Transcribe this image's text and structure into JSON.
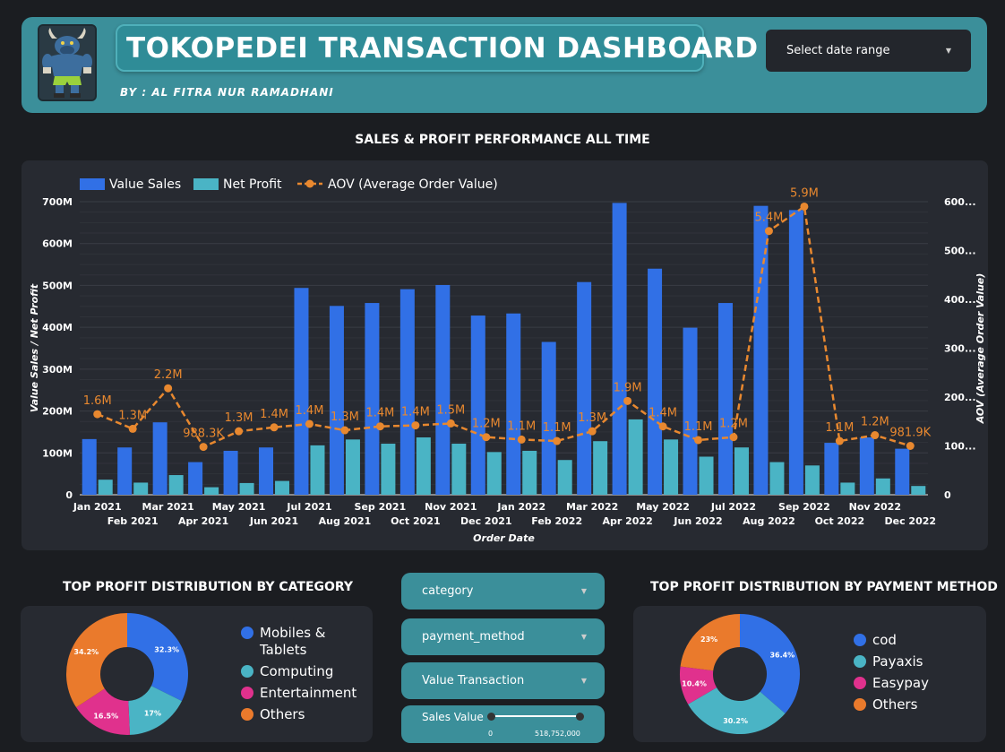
{
  "header": {
    "title": "TOKOPEDEI TRANSACTION DASHBOARD",
    "byline": "BY : AL FITRA NUR RAMADHANI",
    "date_select_label": "Select date range",
    "colors": {
      "bar": "#3b8f9a",
      "title_box": "#2f8c97"
    },
    "avatar_icon": "bull-mascot-icon"
  },
  "sections": {
    "main_chart_title": "SALES & PROFIT PERFORMANCE ALL TIME",
    "category_title": "TOP PROFIT DISTRIBUTION BY CATEGORY",
    "payment_title": "TOP PROFIT DISTRIBUTION BY PAYMENT METHOD"
  },
  "filters": {
    "category": "category",
    "payment_method": "payment_method",
    "value_transaction": "Value Transaction",
    "slider_label": "Sales Value",
    "slider_min": "0",
    "slider_max": "518,752,000"
  },
  "chart_data": [
    {
      "type": "bar",
      "title": "SALES & PROFIT PERFORMANCE ALL TIME",
      "xlabel": "Order Date",
      "ylabel": "Value Sales / Net Profit",
      "y2label": "AOV (Average Order Value)",
      "ylim": [
        0,
        700
      ],
      "y2lim": [
        0,
        600
      ],
      "yticks": [
        "0",
        "100M",
        "200M",
        "300M",
        "400M",
        "500M",
        "600M",
        "700M"
      ],
      "y2ticks": [
        "0",
        "100...",
        "200...",
        "300...",
        "400...",
        "500...",
        "600..."
      ],
      "legend": [
        "Value Sales",
        "Net Profit",
        "AOV (Average Order Value)"
      ],
      "legend_position": "top-left",
      "colors": {
        "sales": "#3170e6",
        "profit": "#4ab4c5",
        "aov": "#e8882f"
      },
      "categories": [
        "Jan 2021",
        "Feb 2021",
        "Mar 2021",
        "Apr 2021",
        "May 2021",
        "Jun 2021",
        "Jul 2021",
        "Aug 2021",
        "Sep 2021",
        "Oct 2021",
        "Nov 2021",
        "Dec 2021",
        "Jan 2022",
        "Feb 2022",
        "Mar 2022",
        "Apr 2022",
        "May 2022",
        "Jun 2022",
        "Jul 2022",
        "Aug 2022",
        "Sep 2022",
        "Oct 2022",
        "Nov 2022",
        "Dec 2022"
      ],
      "series": [
        {
          "name": "Value Sales",
          "unit": "M",
          "values": [
            133,
            113,
            173,
            78,
            105,
            113,
            494,
            451,
            458,
            491,
            501,
            428,
            433,
            365,
            508,
            697,
            540,
            399,
            458,
            690,
            680,
            124,
            137,
            110
          ]
        },
        {
          "name": "Net Profit",
          "unit": "M",
          "values": [
            36,
            29,
            47,
            18,
            28,
            33,
            118,
            132,
            122,
            137,
            122,
            102,
            105,
            83,
            128,
            180,
            132,
            91,
            113,
            78,
            70,
            29,
            39,
            21
          ]
        },
        {
          "name": "AOV (Average Order Value)",
          "values": [
            165,
            135,
            218,
            98,
            130,
            138,
            145,
            132,
            140,
            142,
            146,
            118,
            113,
            110,
            130,
            192,
            140,
            112,
            118,
            540,
            590,
            110,
            122,
            100
          ],
          "labels": [
            "1.6M",
            "1.3M",
            "2.2M",
            "988.3K",
            "1.3M",
            "1.4M",
            "1.4M",
            "1.3M",
            "1.4M",
            "1.4M",
            "1.5M",
            "1.2M",
            "1.1M",
            "1.1M",
            "1.3M",
            "1.9M",
            "1.4M",
            "1.1M",
            "1.2M",
            "5.4M",
            "5.9M",
            "1.1M",
            "1.2M",
            "981.9K"
          ]
        }
      ]
    },
    {
      "type": "pie",
      "title": "TOP PROFIT DISTRIBUTION BY CATEGORY",
      "categories": [
        "Mobiles & Tablets",
        "Computing",
        "Entertainment",
        "Others"
      ],
      "values": [
        32.3,
        17,
        16.5,
        34.2
      ],
      "value_labels": [
        "32.3%",
        "17%",
        "16.5%",
        "34.2%"
      ],
      "colors": [
        "#3170e6",
        "#4ab4c5",
        "#e0318d",
        "#ea7a2c"
      ]
    },
    {
      "type": "pie",
      "title": "TOP PROFIT DISTRIBUTION BY PAYMENT METHOD",
      "categories": [
        "cod",
        "Payaxis",
        "Easypay",
        "Others"
      ],
      "values": [
        36.4,
        30.2,
        10.4,
        23
      ],
      "value_labels": [
        "36.4%",
        "30.2%",
        "10.4%",
        "23%"
      ],
      "colors": [
        "#3170e6",
        "#4ab4c5",
        "#e0318d",
        "#ea7a2c"
      ]
    }
  ]
}
